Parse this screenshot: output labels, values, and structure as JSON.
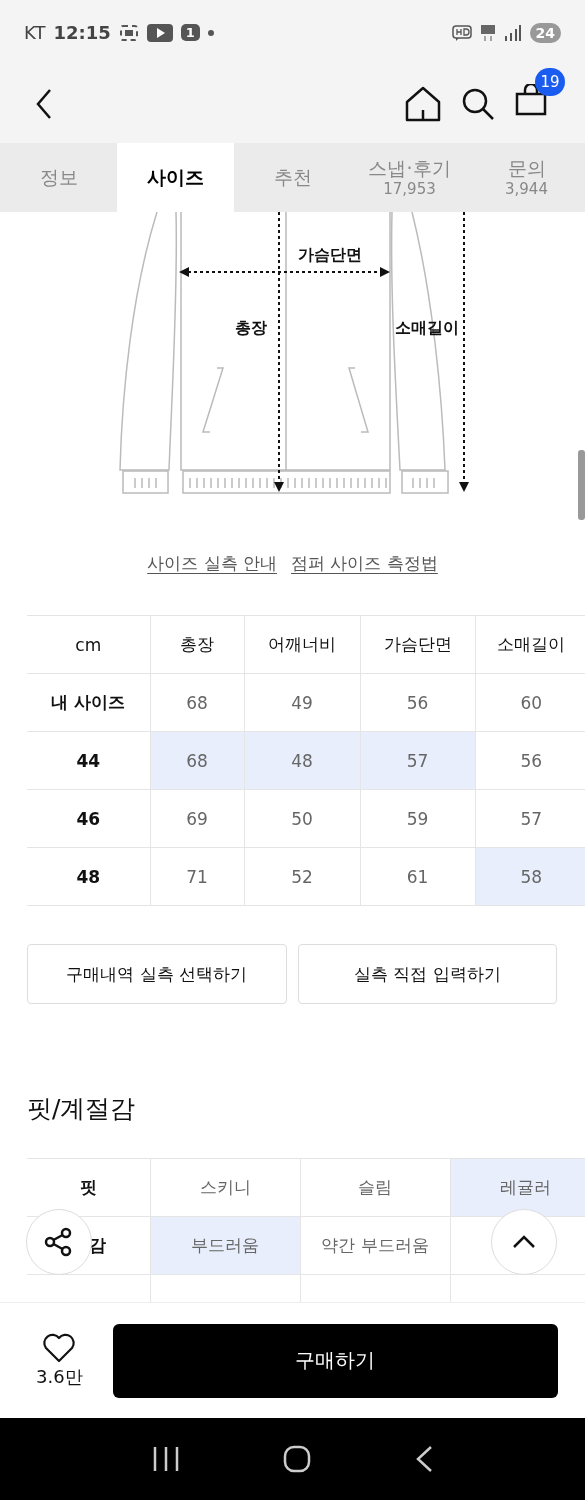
{
  "status_bar": {
    "carrier": "KT",
    "time": "12:15",
    "notification_count": "1",
    "battery": "24"
  },
  "header": {
    "cart_badge": "19"
  },
  "tabs": [
    {
      "label": "정보",
      "selected": false
    },
    {
      "label": "사이즈",
      "selected": true
    },
    {
      "label": "추천",
      "selected": false
    },
    {
      "label": "스냅·후기",
      "count": "17,953",
      "selected": false
    },
    {
      "label": "문의",
      "count": "3,944",
      "selected": false
    }
  ],
  "size_diagram": {
    "labels": [
      "가슴단면",
      "총장",
      "소매길이"
    ]
  },
  "guide_links": [
    "사이즈 실측 안내",
    "점퍼 사이즈 측정법"
  ],
  "size_table": {
    "columns": [
      "cm",
      "총장",
      "어깨너비",
      "가슴단면",
      "소매길이"
    ],
    "rows": [
      {
        "cells": [
          {
            "text": "내 사이즈",
            "highlighted": false
          },
          {
            "text": "68",
            "highlighted": false
          },
          {
            "text": "49",
            "highlighted": false
          },
          {
            "text": "56",
            "highlighted": false
          },
          {
            "text": "60",
            "highlighted": false
          }
        ]
      },
      {
        "cells": [
          {
            "text": "44",
            "highlighted": false
          },
          {
            "text": "68",
            "highlighted": true
          },
          {
            "text": "48",
            "highlighted": true
          },
          {
            "text": "57",
            "highlighted": true
          },
          {
            "text": "56",
            "highlighted": false
          }
        ]
      },
      {
        "cells": [
          {
            "text": "46",
            "highlighted": false
          },
          {
            "text": "69",
            "highlighted": false
          },
          {
            "text": "50",
            "highlighted": false
          },
          {
            "text": "59",
            "highlighted": false
          },
          {
            "text": "57",
            "highlighted": false
          }
        ]
      },
      {
        "cells": [
          {
            "text": "48",
            "highlighted": false
          },
          {
            "text": "71",
            "highlighted": false
          },
          {
            "text": "52",
            "highlighted": false
          },
          {
            "text": "61",
            "highlighted": false
          },
          {
            "text": "58",
            "highlighted": true
          }
        ]
      }
    ]
  },
  "measure_buttons": [
    "구매내역 실측 선택하기",
    "실측 직접 입력하기"
  ],
  "fit_section": {
    "title": "핏/계절감",
    "rows": [
      {
        "label": "핏",
        "cells": [
          {
            "text": "스키니",
            "highlighted": false
          },
          {
            "text": "슬림",
            "highlighted": false
          },
          {
            "text": "레귤러",
            "highlighted": true
          }
        ]
      },
      {
        "label": "감",
        "cells": [
          {
            "text": "부드러움",
            "highlighted": true
          },
          {
            "text": "약간 부드러움",
            "highlighted": false
          }
        ]
      }
    ]
  },
  "bottom_bar": {
    "like_count": "3.6만",
    "buy_button": "구매하기"
  }
}
